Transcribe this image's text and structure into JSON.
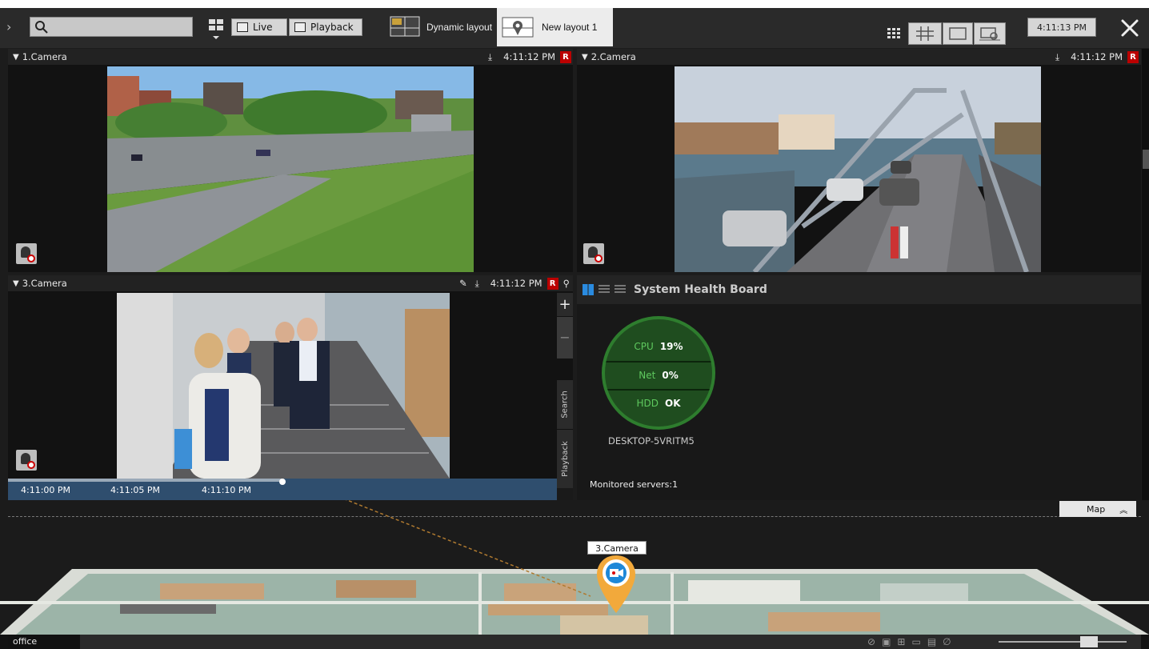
{
  "topbar": {
    "live_label": "Live",
    "playback_label": "Playback",
    "tabs": [
      {
        "label": "Dynamic layout"
      },
      {
        "label": "New layout 1"
      }
    ],
    "clock": "4:11:13 PM"
  },
  "cameras": [
    {
      "name": "1.Camera",
      "time": "4:11:12 PM",
      "rec_badge": "R"
    },
    {
      "name": "2.Camera",
      "time": "4:11:12 PM",
      "rec_badge": "R"
    },
    {
      "name": "3.Camera",
      "time": "4:11:12 PM",
      "rec_badge": "R"
    }
  ],
  "camera3": {
    "side_buttons": {
      "search": "Search",
      "playback": "Playback",
      "plus": "+",
      "minus": "−"
    },
    "timeline_ticks": [
      "4:11:00 PM",
      "4:11:05 PM",
      "4:11:10 PM"
    ]
  },
  "health": {
    "title": "System Health Board",
    "cpu_label": "CPU",
    "cpu_value": "19%",
    "net_label": "Net",
    "net_value": "0%",
    "hdd_label": "HDD",
    "hdd_value": "OK",
    "server_name": "DESKTOP-5VRITM5",
    "monitored": "Monitored servers:1"
  },
  "map": {
    "toggle_label": "Map",
    "pin_label": "3.Camera"
  },
  "statusbar": {
    "layout_name": "office"
  },
  "colors": {
    "rec_red": "#b00000",
    "health_green": "#2e7d2e",
    "pin_orange": "#f2a93b",
    "pin_blue": "#1e88d8"
  },
  "icons": [
    "search-icon",
    "layout-grid-icon",
    "live-icon",
    "playback-icon",
    "dynamic-layout-icon",
    "map-layout-icon",
    "grid-view-icon",
    "hash-grid-icon",
    "single-view-icon",
    "map-view-icon",
    "tools-icon",
    "download-icon",
    "rec-icon",
    "map-pin-icon",
    "edit-icon",
    "camera-pin-icon"
  ]
}
